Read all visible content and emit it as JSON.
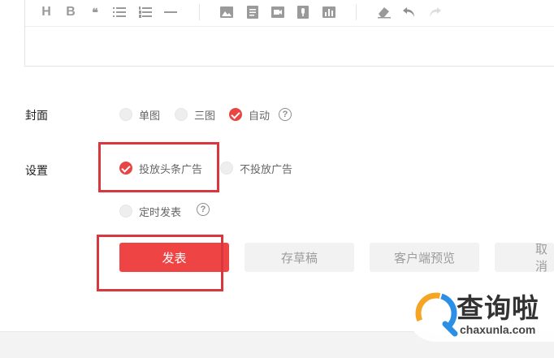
{
  "editor": {
    "toolbar": {
      "heading": "H",
      "bold": "B",
      "quote": "❝"
    }
  },
  "cover": {
    "label": "封面",
    "options": [
      {
        "label": "单图",
        "checked": false
      },
      {
        "label": "三图",
        "checked": false
      },
      {
        "label": "自动",
        "checked": true
      }
    ],
    "help": "?"
  },
  "settings": {
    "label": "设置",
    "ads": [
      {
        "label": "投放头条广告",
        "checked": true
      },
      {
        "label": "不投放广告",
        "checked": false
      }
    ],
    "schedule": {
      "label": "定时发表",
      "checked": false
    },
    "help": "?"
  },
  "actions": {
    "publish": "发表",
    "save_draft": "存草稿",
    "client_preview": "客户端预览",
    "cancel": "取 消"
  },
  "watermark": {
    "title": "查询啦",
    "url": "chaxunla.com"
  },
  "colors": {
    "accent": "#ee4444",
    "highlight": "#d9363e"
  }
}
